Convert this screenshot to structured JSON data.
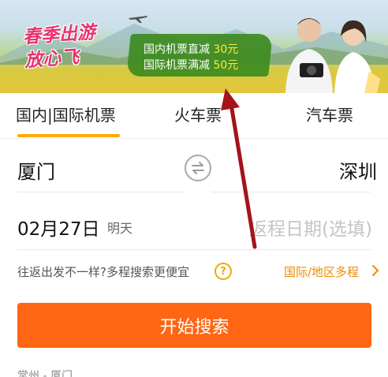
{
  "banner": {
    "promo_title_line1": "春季出游",
    "promo_title_line2": "放心飞",
    "domestic_text": "国内机票直减",
    "domestic_amount": "30元",
    "international_text": "国际机票满减",
    "international_amount": "50元"
  },
  "tabs": [
    {
      "label": "国内|国际机票",
      "active": true
    },
    {
      "label": "火车票",
      "active": false
    },
    {
      "label": "汽车票",
      "active": false
    }
  ],
  "route": {
    "from_city": "厦门",
    "to_city": "深圳"
  },
  "dates": {
    "depart": "02月27日",
    "depart_sub": "明天",
    "return_placeholder": "返程日期(选填)"
  },
  "tips": {
    "multi_trip_hint": "往返出发不一样?多程搜索更便宜",
    "multi_trip_link": "国际/地区多程"
  },
  "search_button_label": "开始搜索",
  "history": {
    "item": "常州 - 厦门"
  },
  "colors": {
    "accent_orange": "#ff6613",
    "tab_underline": "#ffa800",
    "link_orange": "#f08a00",
    "arrow_red": "#a4141b"
  },
  "icons": {
    "swap": "swap-icon",
    "help": "help-icon",
    "chevron": "chevron-right-icon",
    "annotation": "red-arrow"
  }
}
